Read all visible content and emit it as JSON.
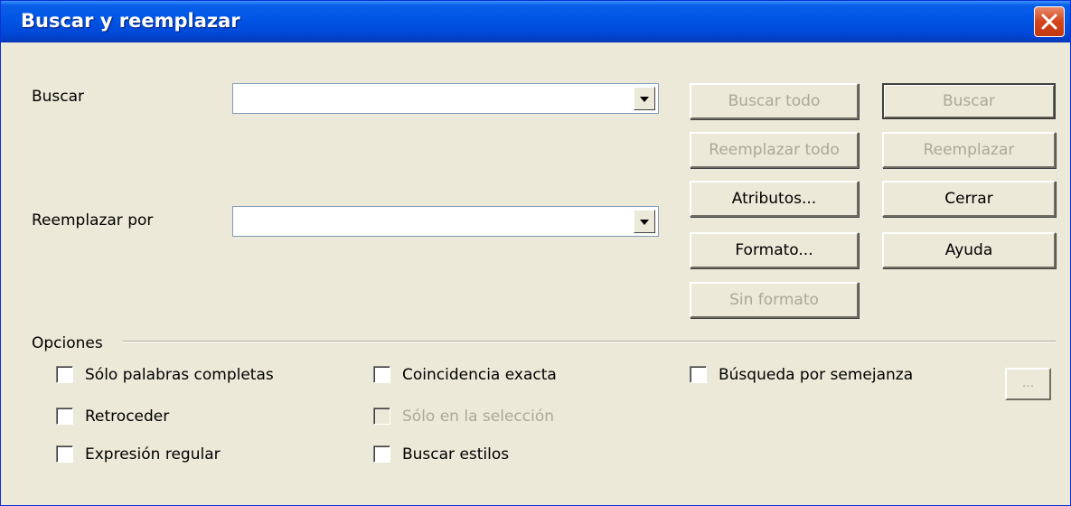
{
  "window": {
    "title": "Buscar y reemplazar"
  },
  "search": {
    "label": "Buscar",
    "value": ""
  },
  "replace": {
    "label": "Reemplazar por",
    "value": ""
  },
  "buttons": {
    "find_all": "Buscar todo",
    "find": "Buscar",
    "replace_all": "Reemplazar todo",
    "replace": "Reemplazar",
    "attributes": "Atributos...",
    "close": "Cerrar",
    "format": "Formato...",
    "help": "Ayuda",
    "no_format": "Sin formato"
  },
  "options": {
    "label": "Opciones",
    "whole_words": "Sólo palabras completas",
    "backwards": "Retroceder",
    "regex": "Expresión regular",
    "match_case": "Coincidencia exacta",
    "selection_only": "Sólo en la selección",
    "search_styles": "Buscar estilos",
    "similarity": "Búsqueda por semejanza",
    "similarity_button": "..."
  },
  "colors": {
    "titlebar": "#0055e5",
    "dialog_bg": "#ece9d8",
    "disabled_text": "#aca899",
    "close_button": "#d4441c"
  },
  "icons": {
    "close": "close-icon",
    "combo_arrow": "chevron-down-icon"
  }
}
